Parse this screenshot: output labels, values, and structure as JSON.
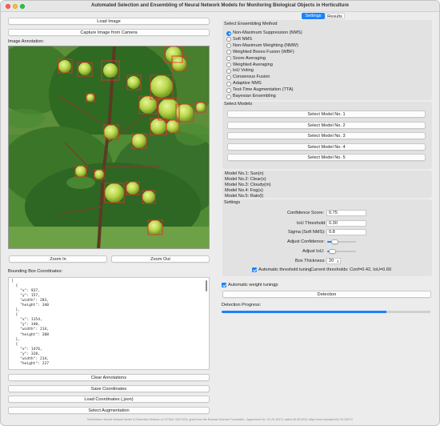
{
  "window": {
    "title": "Automated Selection and Ensembling of Neural Network Models for Monitoring Biological Objects in Horticulture"
  },
  "left": {
    "load_image": "Load Image",
    "capture_image": "Capture Image from Camera",
    "image_annotation_label": "Image Annotation:",
    "zoom_in": "Zoom In",
    "zoom_out": "Zoom Out",
    "bbox_label": "Bounding Box Coordinates:",
    "bbox_text": "[\n  {\n    \"x\": 927,\n    \"y\": 157,\n    \"width\": 283,\n    \"height\": 340\n  },\n  {\n    \"x\": 1154,\n    \"y\": 340,\n    \"width\": 214,\n    \"height\": 208\n  },\n  {\n    \"x\": 1476,\n    \"y\": 328,\n    \"width\": 214,\n    \"height\": 227",
    "clear_annotations": "Clear Annotations",
    "save_coordinates": "Save Coordinates",
    "load_coordinates": "Load Coordinates (.json)",
    "select_augmentation": "Select Augmentation"
  },
  "tabs": [
    "Settings",
    "Results"
  ],
  "ensembling": {
    "section_label": "Select Ensembling Method",
    "selected_index": 0,
    "methods": [
      "Non-Maximum Suppression (NMS)",
      "Soft NMS",
      "Non-Maximum Weighting (NMW)",
      "Weighted Boxes Fusion (WBF)",
      "Score Averaging",
      "Weighted Averaging",
      "IoU Voting",
      "Consensus Fusion",
      "Adaptive NMS",
      "Test-Time Augmentation (TTA)",
      "Bayesian Ensembling"
    ]
  },
  "models": {
    "section_label": "Select Models",
    "buttons": [
      "Select Model No. 1",
      "Select Model No. 2",
      "Select Model No. 3",
      "Select Model No. 4",
      "Select Model No. 5"
    ],
    "assigned": [
      "Model No.1: Sun(n)",
      "Model No.2: Clear(x)",
      "Model No.3: Cloudy(m)",
      "Model No.4: Fog(s)",
      "Model No.5: Rain(l)"
    ]
  },
  "settings": {
    "section_label": "Settings",
    "confidence_label": "Confidence Score:",
    "confidence_value": "0.75",
    "iou_label": "IoU Threshold:",
    "iou_value": "0.30",
    "sigma_label": "Sigma (Soft NMS):",
    "sigma_value": "0.8",
    "adjust_confidence_label": "Adjust Confidence:",
    "adjust_confidence_level": 0.2,
    "adjust_iou_label": "Adjust IoU:",
    "adjust_iou_level": 0.1,
    "box_thickness_label": "Box Thickness:",
    "box_thickness_value": "20",
    "auto_threshold_label": "Automatic threshold tuning",
    "auto_threshold_status": "Current thresholds: Conf=0.42, IoU=0.60",
    "auto_weight_label": "Automatic weight tuningp",
    "detection_button": "Detection",
    "progress_label": "Detection Progress:",
    "progress_value": 0.79
  },
  "footer": "NorthVision: Neural Network Model & Ensemble Selector v1.0 FSAC VIM 2024, grant from the Russian Science Foundation - Agreement No. 24-76-10071, dated 06.08.2024, https://rscf.ru/project/24-76-10071/",
  "colors": {
    "accent": "#1a82fb",
    "bbox_red": "#e0352b"
  }
}
